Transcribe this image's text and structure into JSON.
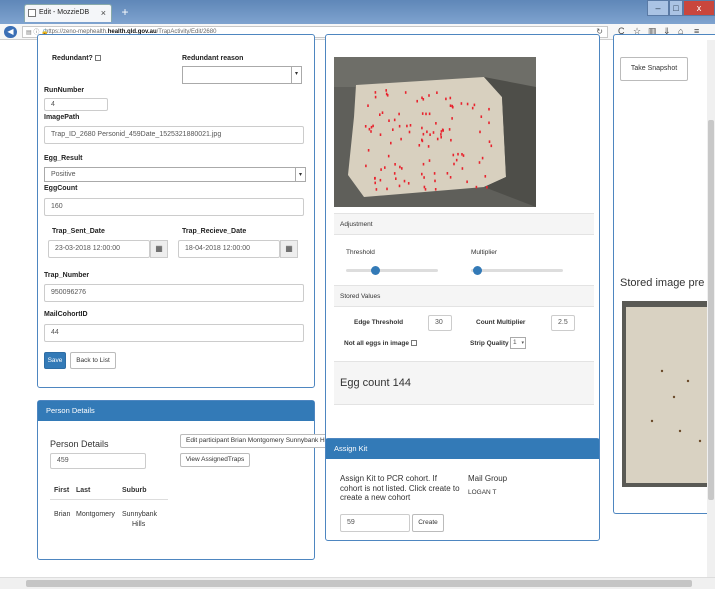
{
  "browser": {
    "tab_title": "Edit - MozzieDB",
    "new_tab": "+",
    "url_prefix": "https://zeno-mephealth.",
    "url_host": "health.qld.gov.au",
    "url_path": "/TrapActivity/Edit/2680"
  },
  "form": {
    "redundant_label": "Redundant?",
    "redundant_reason_label": "Redundant reason",
    "run_number_label": "RunNumber",
    "run_number_value": "4",
    "image_path_label": "ImagePath",
    "image_path_value": "Trap_ID_2680 Personid_459Date_1525321880021.jpg",
    "egg_result_label": "Egg_Result",
    "egg_result_value": "Positive",
    "egg_count_label": "EggCount",
    "egg_count_value": "160",
    "trap_sent_label": "Trap_Sent_Date",
    "trap_sent_value": "23-03-2018 12:00:00",
    "trap_recieve_label": "Trap_Recieve_Date",
    "trap_recieve_value": "18-04-2018 12:00:00",
    "trap_number_label": "Trap_Number",
    "trap_number_value": "950096276",
    "mail_cohort_label": "MailCohortID",
    "mail_cohort_value": "44",
    "save_label": "Save",
    "back_label": "Back to List"
  },
  "person": {
    "header": "Person Details",
    "title": "Person Details",
    "id_value": "459",
    "edit_button": "Edit participant Brian Montgomery Sunnybank Hills",
    "view_button": "View AssignedTraps",
    "col_first": "First",
    "col_last": "Last",
    "col_suburb": "Suburb",
    "first": "Brian",
    "last": "Montgomery",
    "suburb_line1": "Sunnybank",
    "suburb_line2": "Hills"
  },
  "analysis": {
    "adjustment_label": "Adjustment",
    "threshold_label": "Threshold",
    "multiplier_label": "Multiplier",
    "threshold_level": 0.32,
    "multiplier_level": 0.07,
    "stored_values_label": "Stored Values",
    "edge_threshold_label": "Edge Threshold",
    "edge_threshold_value": "30",
    "count_multiplier_label": "Count Multiplier",
    "count_multiplier_value": "2.5",
    "not_all_eggs_label": "Not all eggs in image",
    "strip_quality_label": "Strip Quality",
    "strip_quality_value": "1",
    "egg_count_text": "Egg count 144"
  },
  "assign_kit": {
    "header": "Assign Kit",
    "description": "Assign Kit to PCR cohort. If cohort is not listed. Click create to create a new cohort",
    "mail_group_label": "Mail Group",
    "mail_group_value": "LOGAN T",
    "cohort_value": "59",
    "create_label": "Create"
  },
  "snapshot": {
    "take_snapshot_label": "Take Snapshot",
    "stored_preview_label": "Stored image pre"
  },
  "colors": {
    "primary": "#337ab7",
    "panel_border": "#4e86c0",
    "egg_marks": "#e8232e"
  }
}
